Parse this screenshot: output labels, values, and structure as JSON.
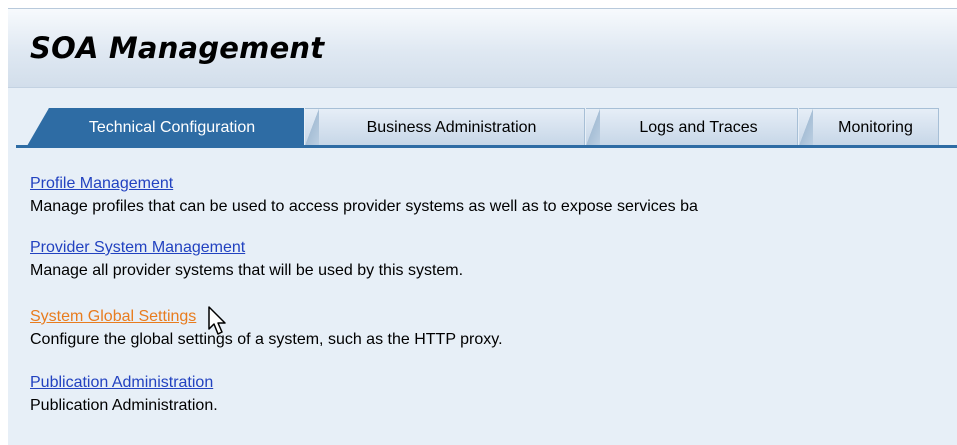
{
  "header": {
    "title": "SOA Management"
  },
  "tabs": [
    {
      "label": "Technical Configuration",
      "active": true
    },
    {
      "label": "Business Administration",
      "active": false
    },
    {
      "label": "Logs and Traces",
      "active": false
    },
    {
      "label": "Monitoring",
      "active": false
    }
  ],
  "items": [
    {
      "link": "Profile Management",
      "description": "Manage profiles that can be used to access provider systems as well as to expose services ba"
    },
    {
      "link": "Provider System Management",
      "description": "Manage all provider systems that will be used by this system."
    },
    {
      "link": "System Global Settings",
      "description": "Configure the global settings of a system, such as the HTTP proxy.",
      "hovered": true
    },
    {
      "link": "Publication Administration",
      "description": "Publication Administration."
    }
  ],
  "colors": {
    "active_tab": "#2e6ca4",
    "link": "#2242c0",
    "link_hover": "#e87c1e",
    "content_bg": "#e7eff7"
  },
  "icons": {
    "cursor": "mouse-pointer-icon"
  }
}
